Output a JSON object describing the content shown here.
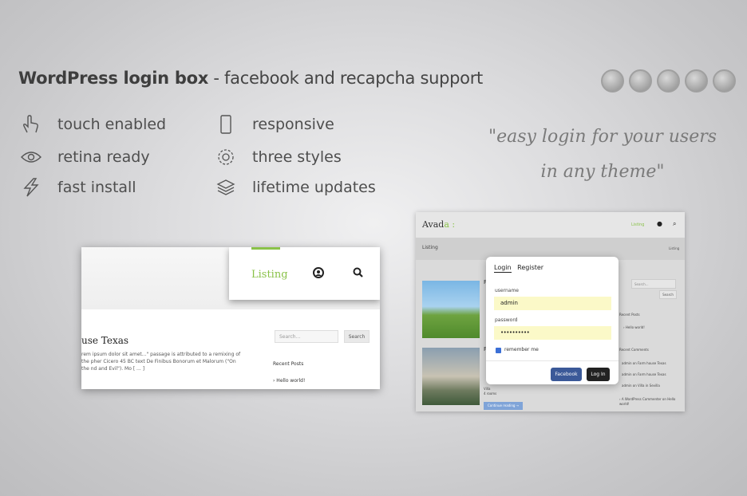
{
  "title": {
    "bold": "WordPress login box",
    "dash": "-",
    "rest": "facebook and recapcha support"
  },
  "features": [
    {
      "label": "touch enabled",
      "icon": "hand-icon"
    },
    {
      "label": "retina ready",
      "icon": "eye-icon"
    },
    {
      "label": "fast install",
      "icon": "lightning-icon"
    },
    {
      "label": "responsive",
      "icon": "phone-icon"
    },
    {
      "label": "three styles",
      "icon": "gear-icon"
    },
    {
      "label": "lifetime updates",
      "icon": "layers-icon"
    }
  ],
  "browsers": [
    "chrome-icon",
    "firefox-icon",
    "ie-icon",
    "opera-icon",
    "safari-icon"
  ],
  "quote": {
    "line1": "\"easy login for your users",
    "line2": "in any theme\""
  },
  "card1": {
    "menu_listing": "Listing",
    "heading": "use Texas",
    "paragraph": "rem ipsum dolor sit amet...\" passage is attributed to a remixing of the pher Cicero 45 BC text De Finibus Bonorum et Malorum (\"On the nd and Evil\"). Mo [ ... ]",
    "search_placeholder": "Search...",
    "search_button": "Search",
    "recent_posts": "Recent Posts",
    "recent_item": "› Hello world!"
  },
  "card2": {
    "logo": "Avad",
    "logo_suffix": "a :",
    "nav_listing": "Listing",
    "bar_title": "Listing",
    "bar_right": "Listing",
    "post1_initial": "F",
    "post2_initial": "P",
    "villa": "Villa",
    "rooms": "4 rooms",
    "continue": "Continue reading →",
    "search_placeholder": "Search...",
    "search_button": "Search",
    "recent_posts": "Recent Posts",
    "hello": "› Hello world!",
    "recent_comments": "Recent Comments",
    "comment1": "admin on Farm house Texas",
    "comment2": "admin on Farm house Texas",
    "comment3": "admin on Villa in Sevilla",
    "comment4": "› A WordPress Commenter on Hello world!"
  },
  "login": {
    "tab_login": "Login",
    "tab_register": "Register",
    "username_label": "username",
    "username_value": "admin",
    "password_label": "password",
    "password_value": "••••••••••",
    "remember": "remember me",
    "facebook_button": "Facebook",
    "login_button": "Log In"
  },
  "colors": {
    "accent_green": "#8ac249",
    "facebook": "#3b5998",
    "input_yellow": "#fbf9c8"
  }
}
